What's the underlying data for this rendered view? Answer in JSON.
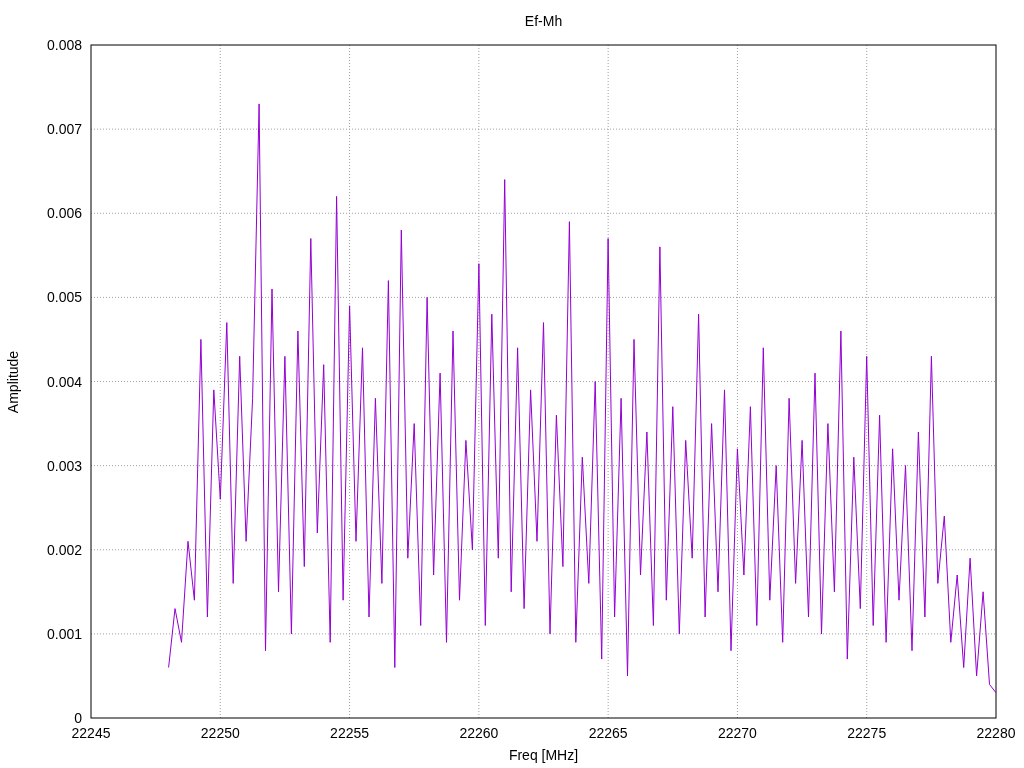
{
  "chart_data": {
    "type": "line",
    "title": "Ef-Mh",
    "xlabel": "Freq [MHz]",
    "ylabel": "Amplitude",
    "xlim": [
      22245,
      22280
    ],
    "ylim": [
      0,
      0.008
    ],
    "xticks": [
      22245,
      22250,
      22255,
      22260,
      22265,
      22270,
      22275,
      22280
    ],
    "yticks": [
      0,
      0.001,
      0.002,
      0.003,
      0.004,
      0.005,
      0.006,
      0.007,
      0.008
    ],
    "x": [
      22248,
      22248.25,
      22248.5,
      22248.75,
      22249,
      22249.25,
      22249.5,
      22249.75,
      22250,
      22250.25,
      22250.5,
      22250.75,
      22251,
      22251.25,
      22251.5,
      22251.75,
      22252,
      22252.25,
      22252.5,
      22252.75,
      22253,
      22253.25,
      22253.5,
      22253.75,
      22254,
      22254.25,
      22254.5,
      22254.75,
      22255,
      22255.25,
      22255.5,
      22255.75,
      22256,
      22256.25,
      22256.5,
      22256.75,
      22257,
      22257.25,
      22257.5,
      22257.75,
      22258,
      22258.25,
      22258.5,
      22258.75,
      22259,
      22259.25,
      22259.5,
      22259.75,
      22260,
      22260.25,
      22260.5,
      22260.75,
      22261,
      22261.25,
      22261.5,
      22261.75,
      22262,
      22262.25,
      22262.5,
      22262.75,
      22263,
      22263.25,
      22263.5,
      22263.75,
      22264,
      22264.25,
      22264.5,
      22264.75,
      22265,
      22265.25,
      22265.5,
      22265.75,
      22266,
      22266.25,
      22266.5,
      22266.75,
      22267,
      22267.25,
      22267.5,
      22267.75,
      22268,
      22268.25,
      22268.5,
      22268.75,
      22269,
      22269.25,
      22269.5,
      22269.75,
      22270,
      22270.25,
      22270.5,
      22270.75,
      22271,
      22271.25,
      22271.5,
      22271.75,
      22272,
      22272.25,
      22272.5,
      22272.75,
      22273,
      22273.25,
      22273.5,
      22273.75,
      22274,
      22274.25,
      22274.5,
      22274.75,
      22275,
      22275.25,
      22275.5,
      22275.75,
      22276,
      22276.25,
      22276.5,
      22276.75,
      22277,
      22277.25,
      22277.5,
      22277.75,
      22278,
      22278.25,
      22278.5,
      22278.75,
      22279,
      22279.25,
      22279.5,
      22279.75,
      22280
    ],
    "grid": true,
    "series": [
      {
        "color": "#9400d3",
        "values": [
          0.0006,
          0.0013,
          0.0009,
          0.0021,
          0.0014,
          0.0045,
          0.0012,
          0.0039,
          0.0026,
          0.0047,
          0.0016,
          0.0043,
          0.0021,
          0.0038,
          0.0073,
          0.0008,
          0.0051,
          0.0015,
          0.0043,
          0.001,
          0.0046,
          0.0018,
          0.0057,
          0.0022,
          0.0042,
          0.0009,
          0.0062,
          0.0014,
          0.0049,
          0.0021,
          0.0044,
          0.0012,
          0.0038,
          0.0016,
          0.0052,
          0.0006,
          0.0058,
          0.0019,
          0.0035,
          0.0011,
          0.005,
          0.0017,
          0.0041,
          0.0009,
          0.0046,
          0.0014,
          0.0033,
          0.002,
          0.0054,
          0.0011,
          0.0048,
          0.0019,
          0.0064,
          0.0015,
          0.0044,
          0.0013,
          0.0039,
          0.0021,
          0.0047,
          0.001,
          0.0036,
          0.0018,
          0.0059,
          0.0009,
          0.0031,
          0.0016,
          0.004,
          0.0007,
          0.0057,
          0.0012,
          0.0038,
          0.0005,
          0.0045,
          0.0017,
          0.0034,
          0.0011,
          0.0056,
          0.0014,
          0.0037,
          0.001,
          0.0033,
          0.0019,
          0.0048,
          0.0012,
          0.0035,
          0.0015,
          0.0039,
          0.0008,
          0.0032,
          0.0017,
          0.0037,
          0.0011,
          0.0044,
          0.0014,
          0.003,
          0.0009,
          0.0038,
          0.0016,
          0.0033,
          0.0012,
          0.0041,
          0.001,
          0.0035,
          0.0015,
          0.0046,
          0.0007,
          0.0031,
          0.0013,
          0.0043,
          0.0011,
          0.0036,
          0.0009,
          0.0032,
          0.0014,
          0.003,
          0.0008,
          0.0034,
          0.0012,
          0.0043,
          0.0016,
          0.0024,
          0.0009,
          0.0017,
          0.0006,
          0.0019,
          0.0005,
          0.0015,
          0.0004,
          0.0003
        ]
      }
    ]
  }
}
